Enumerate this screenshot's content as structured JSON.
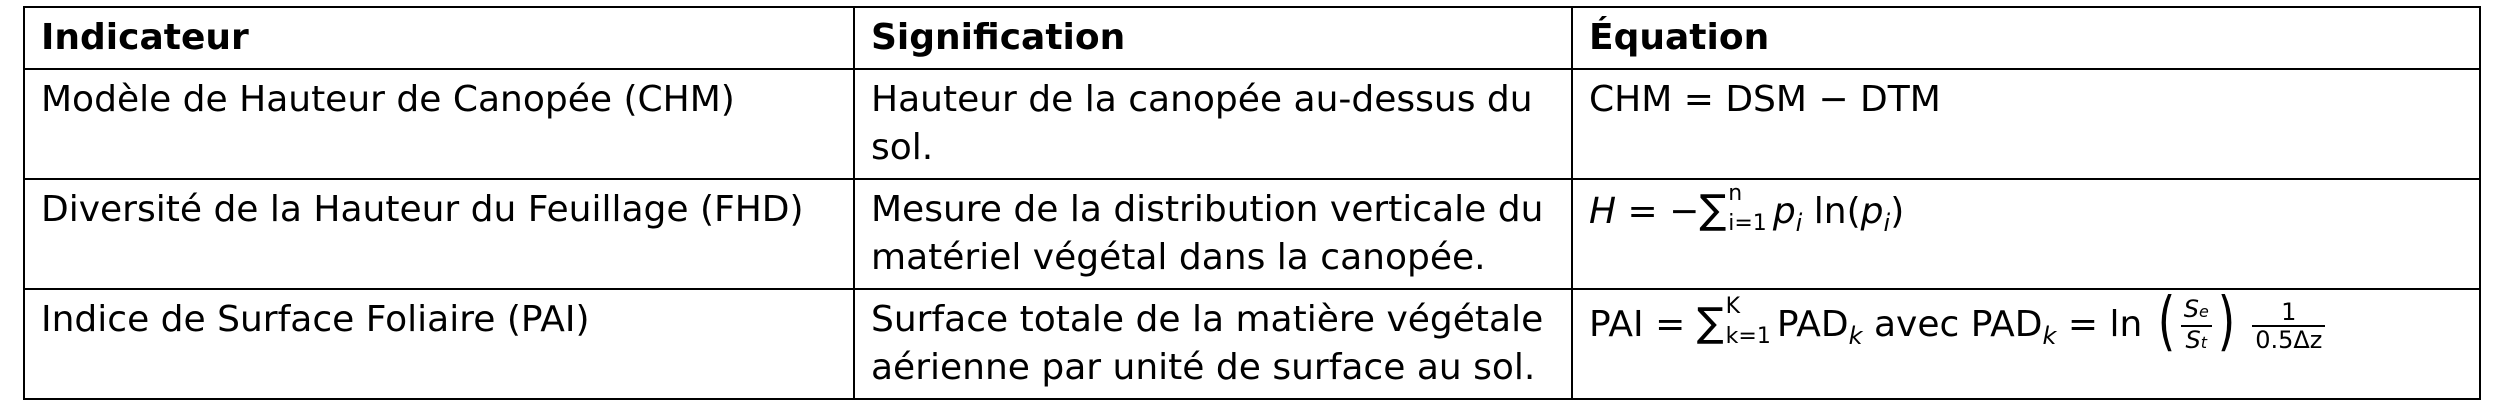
{
  "table": {
    "headers": {
      "indicator": "Indicateur",
      "meaning": "Signification",
      "equation": "Équation"
    },
    "rows": [
      {
        "indicator": "Modèle de Hauteur de Canopée (CHM)",
        "meaning": "Hauteur de la canopée au-dessus du sol.",
        "equation": {
          "text": "CHM = DSM − DTM"
        }
      },
      {
        "indicator": "Diversité de la Hauteur du Feuillage (FHD)",
        "meaning": "Mesure de la distribution verticale du matériel végétal dans la canopée.",
        "equation": {
          "lhs": "H",
          "eq": "= −",
          "sum": "∑",
          "upper": "n",
          "lower": "i=1",
          "p": "p",
          "p_sub": "i",
          "ln": "ln",
          "open": "(",
          "p2": "p",
          "p2_sub": "i",
          "close": ")"
        }
      },
      {
        "indicator": "Indice de Surface Foliaire (PAI)",
        "meaning": "Surface totale de la matière végétale aérienne par unité de surface au sol.",
        "equation": {
          "lhs": "PAI =",
          "sum": "∑",
          "upper": "K",
          "lower": "k=1",
          "pad": "PAD",
          "pad_sub": "k",
          "word": "avec",
          "pad2": "PAD",
          "pad2_sub": "k",
          "eq2": "= ln",
          "paren_open": "(",
          "frac_num": "S",
          "frac_num_sub": "e",
          "frac_den": "S",
          "frac_den_sub": "t",
          "paren_close": ")",
          "frac2_num": "1",
          "frac2_den": "0.5Δz"
        }
      }
    ]
  }
}
